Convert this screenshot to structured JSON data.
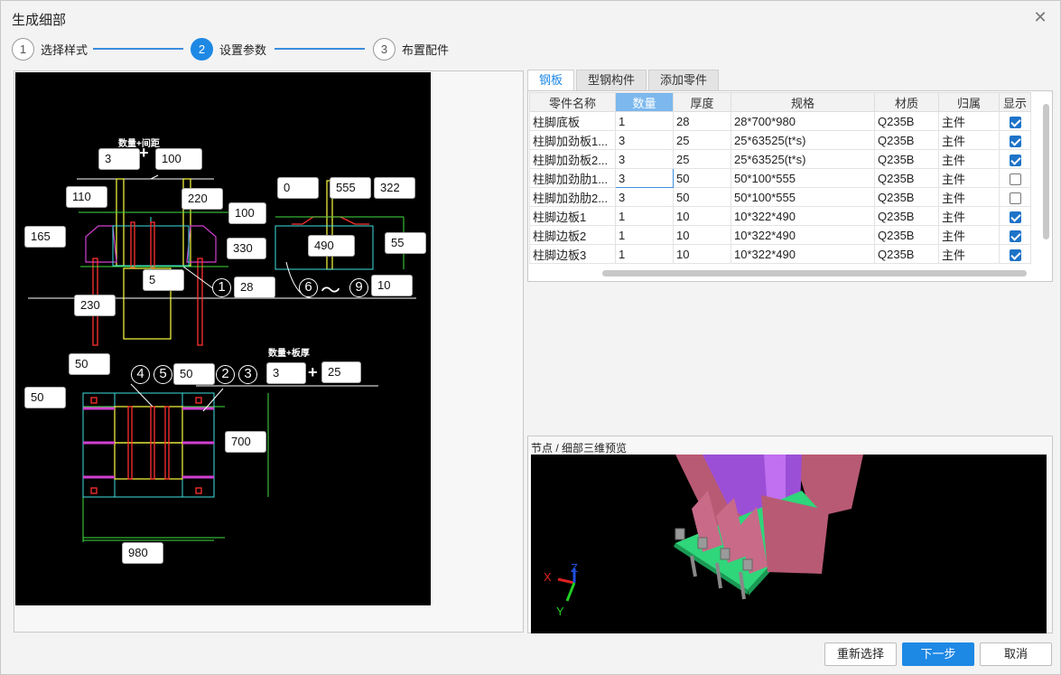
{
  "title": "生成细部",
  "close_icon": "close-icon",
  "steps": [
    {
      "num": "1",
      "label": "选择样式",
      "active": false
    },
    {
      "num": "2",
      "label": "设置参数",
      "active": true
    },
    {
      "num": "3",
      "label": "布置配件",
      "active": false
    }
  ],
  "cad": {
    "label_qty_spacing": "数量+间距",
    "label_qty_thickness": "数量+板厚",
    "plus": "+",
    "tilde": "～",
    "circles": [
      "1",
      "6",
      "9",
      "4",
      "5",
      "2",
      "3"
    ],
    "dims": {
      "qty_top": "3",
      "spacing": "100",
      "d110": "110",
      "d220": "220",
      "d165": "165",
      "d100": "100",
      "d330": "330",
      "d5": "5",
      "d28": "28",
      "d230": "230",
      "d0": "0",
      "d555": "555",
      "d322": "322",
      "d490": "490",
      "d55": "55",
      "d10": "10",
      "d50a": "50",
      "d50b": "50",
      "d50c": "50",
      "qty_bottom": "3",
      "d25": "25",
      "d700": "700",
      "d980": "980"
    }
  },
  "tabs": [
    "钢板",
    "型钢构件",
    "添加零件"
  ],
  "table": {
    "headers": [
      "零件名称",
      "数量",
      "厚度",
      "规格",
      "材质",
      "归属",
      "显示"
    ],
    "rows": [
      {
        "name": "柱脚底板",
        "qty": "1",
        "thk": "28",
        "spec": "28*700*980",
        "mat": "Q235B",
        "owner": "主件",
        "show": true
      },
      {
        "name": "柱脚加劲板1...",
        "qty": "3",
        "thk": "25",
        "spec": "25*63525(t*s)",
        "mat": "Q235B",
        "owner": "主件",
        "show": true
      },
      {
        "name": "柱脚加劲板2...",
        "qty": "3",
        "thk": "25",
        "spec": "25*63525(t*s)",
        "mat": "Q235B",
        "owner": "主件",
        "show": true
      },
      {
        "name": "柱脚加劲肋1...",
        "qty": "3",
        "thk": "50",
        "spec": "50*100*555",
        "mat": "Q235B",
        "owner": "主件",
        "show": false
      },
      {
        "name": "柱脚加劲肋2...",
        "qty": "3",
        "thk": "50",
        "spec": "50*100*555",
        "mat": "Q235B",
        "owner": "主件",
        "show": false
      },
      {
        "name": "柱脚边板1",
        "qty": "1",
        "thk": "10",
        "spec": "10*322*490",
        "mat": "Q235B",
        "owner": "主件",
        "show": true
      },
      {
        "name": "柱脚边板2",
        "qty": "1",
        "thk": "10",
        "spec": "10*322*490",
        "mat": "Q235B",
        "owner": "主件",
        "show": true
      },
      {
        "name": "柱脚边板3",
        "qty": "1",
        "thk": "10",
        "spec": "10*322*490",
        "mat": "Q235B",
        "owner": "主件",
        "show": true
      }
    ]
  },
  "preview": {
    "title": "节点 / 细部三维预览",
    "axis_x": "X",
    "axis_y": "Y",
    "axis_z": "Z"
  },
  "buttons": {
    "reselect": "重新选择",
    "next": "下一步",
    "cancel": "取消"
  },
  "colors": {
    "accent": "#1e88e5",
    "cad_bg": "#000000",
    "plate_pink": "#b85a74",
    "column_purple": "#9b4fd6",
    "base_green": "#2fd67a"
  }
}
